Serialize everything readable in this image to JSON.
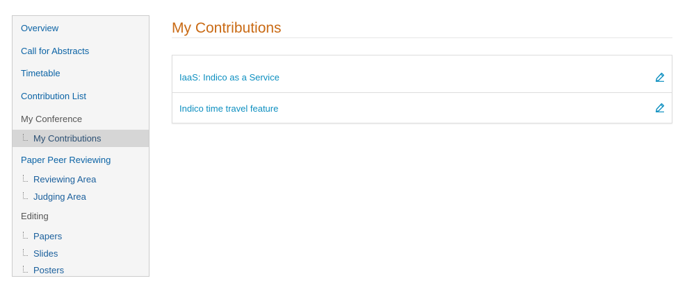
{
  "sidebar": {
    "items": [
      {
        "label": "Overview"
      },
      {
        "label": "Call for Abstracts"
      },
      {
        "label": "Timetable"
      },
      {
        "label": "Contribution List"
      },
      {
        "label": "My Conference"
      },
      {
        "label": "My Contributions"
      },
      {
        "label": "Paper Peer Reviewing"
      },
      {
        "label": "Reviewing Area"
      },
      {
        "label": "Judging Area"
      },
      {
        "label": "Editing"
      },
      {
        "label": "Papers"
      },
      {
        "label": "Slides"
      },
      {
        "label": "Posters"
      }
    ]
  },
  "main": {
    "title": "My Contributions",
    "contributions": [
      {
        "title": "IaaS: Indico as a Service",
        "icon": "edit-icon"
      },
      {
        "title": "Indico time travel feature",
        "icon": "edit-icon"
      }
    ]
  },
  "colors": {
    "title": "#c96a14",
    "link": "#0d8fc0",
    "sidebar_link": "#0b63a5",
    "selected_bg": "#d6d6d6"
  }
}
